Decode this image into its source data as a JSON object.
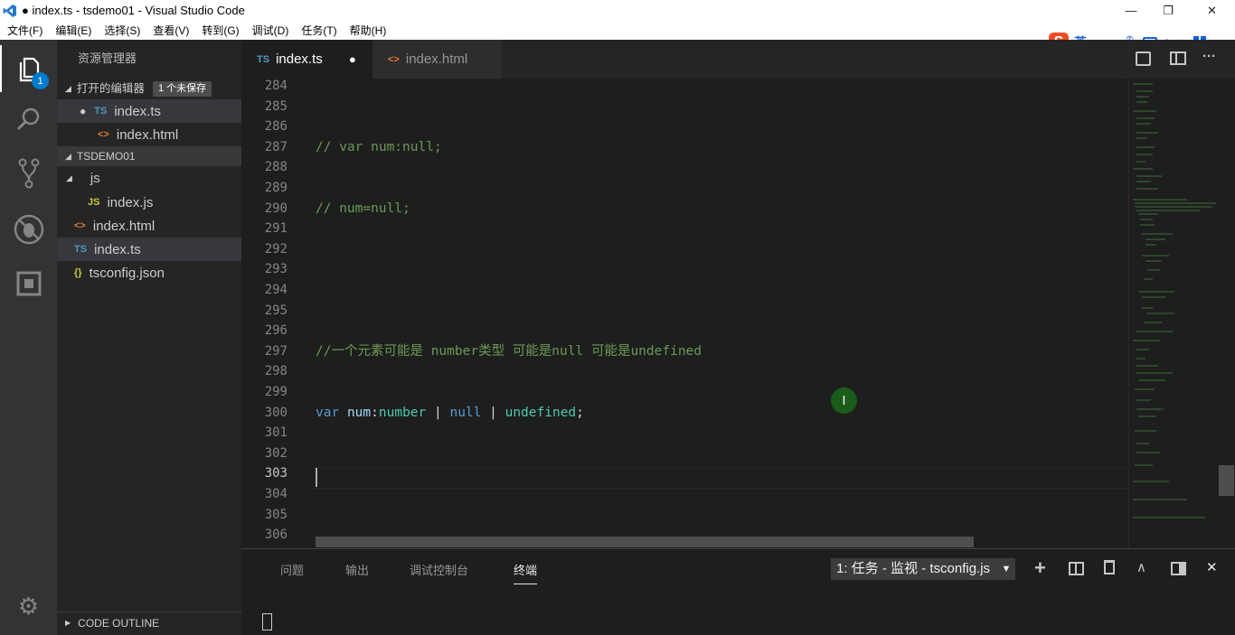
{
  "window": {
    "title": "● index.ts - tsdemo01 - Visual Studio Code",
    "minimize": "—",
    "maximize": "❐",
    "close": "✕"
  },
  "menu": [
    "文件(F)",
    "编辑(E)",
    "选择(S)",
    "查看(V)",
    "转到(G)",
    "调试(D)",
    "任务(T)",
    "帮助(H)"
  ],
  "ime": {
    "lang": "英",
    "punct": "•,"
  },
  "activity": {
    "explorer_badge": "1"
  },
  "sidebar": {
    "title": "资源管理器",
    "open_editors": {
      "label": "打开的编辑器",
      "badge": "1 个未保存",
      "items": [
        {
          "icon": "TS",
          "name": "index.ts",
          "dirty": "●"
        },
        {
          "icon": "<>",
          "name": "index.html"
        }
      ]
    },
    "project": {
      "label": "TSDEMO01",
      "items": [
        {
          "icon": "",
          "name": "js",
          "arrow": "◢"
        },
        {
          "icon": "JS",
          "name": "index.js"
        },
        {
          "icon": "<>",
          "name": "index.html"
        },
        {
          "icon": "TS",
          "name": "index.ts"
        },
        {
          "icon": "{}",
          "name": "tsconfig.json"
        }
      ]
    },
    "outline": {
      "label": "CODE OUTLINE",
      "arrow": "▶"
    }
  },
  "tabs": [
    {
      "icon": "TS",
      "label": "index.ts",
      "dirty": "●"
    },
    {
      "icon": "<>",
      "label": "index.html"
    }
  ],
  "tab_actions": {
    "more": "···"
  },
  "editor": {
    "lines": [
      {
        "n": "284",
        "tokens": []
      },
      {
        "n": "285",
        "tokens": []
      },
      {
        "n": "286",
        "tokens": []
      },
      {
        "n": "287",
        "tokens": [
          {
            "t": "// var num:null;",
            "c": "cm"
          }
        ]
      },
      {
        "n": "288",
        "tokens": []
      },
      {
        "n": "289",
        "tokens": []
      },
      {
        "n": "290",
        "tokens": [
          {
            "t": "// num=null;",
            "c": "cm"
          }
        ]
      },
      {
        "n": "291",
        "tokens": []
      },
      {
        "n": "292",
        "tokens": []
      },
      {
        "n": "293",
        "tokens": []
      },
      {
        "n": "294",
        "tokens": []
      },
      {
        "n": "295",
        "tokens": []
      },
      {
        "n": "296",
        "tokens": []
      },
      {
        "n": "297",
        "tokens": [
          {
            "t": "//一个元素可能是 number类型 可能是null 可能是undefined",
            "c": "cm"
          }
        ]
      },
      {
        "n": "298",
        "tokens": []
      },
      {
        "n": "299",
        "tokens": []
      },
      {
        "n": "300",
        "tokens": [
          {
            "t": "var",
            "c": "kw"
          },
          {
            "t": " ",
            "c": "pl"
          },
          {
            "t": "num",
            "c": "var"
          },
          {
            "t": ":",
            "c": "pl"
          },
          {
            "t": "number",
            "c": "ty"
          },
          {
            "t": " | ",
            "c": "pl"
          },
          {
            "t": "null",
            "c": "kw"
          },
          {
            "t": " | ",
            "c": "pl"
          },
          {
            "t": "undefined",
            "c": "ty"
          },
          {
            "t": ";",
            "c": "pl"
          }
        ]
      },
      {
        "n": "301",
        "tokens": []
      },
      {
        "n": "302",
        "tokens": []
      },
      {
        "n": "303",
        "tokens": [],
        "current": true
      },
      {
        "n": "304",
        "tokens": []
      },
      {
        "n": "305",
        "tokens": []
      },
      {
        "n": "306",
        "tokens": []
      }
    ],
    "cursor_line": "303"
  },
  "panel": {
    "tabs": [
      "问题",
      "输出",
      "调试控制台",
      "终端"
    ],
    "active": "终端",
    "terminal_select": "1: 任务 - 监视 - tsconfig.js",
    "actions": {
      "add": "+",
      "kill": "🗑",
      "maximize": "∧",
      "close": "✕"
    }
  },
  "colors": {
    "accent": "#007acc",
    "badge": "#007acc"
  }
}
